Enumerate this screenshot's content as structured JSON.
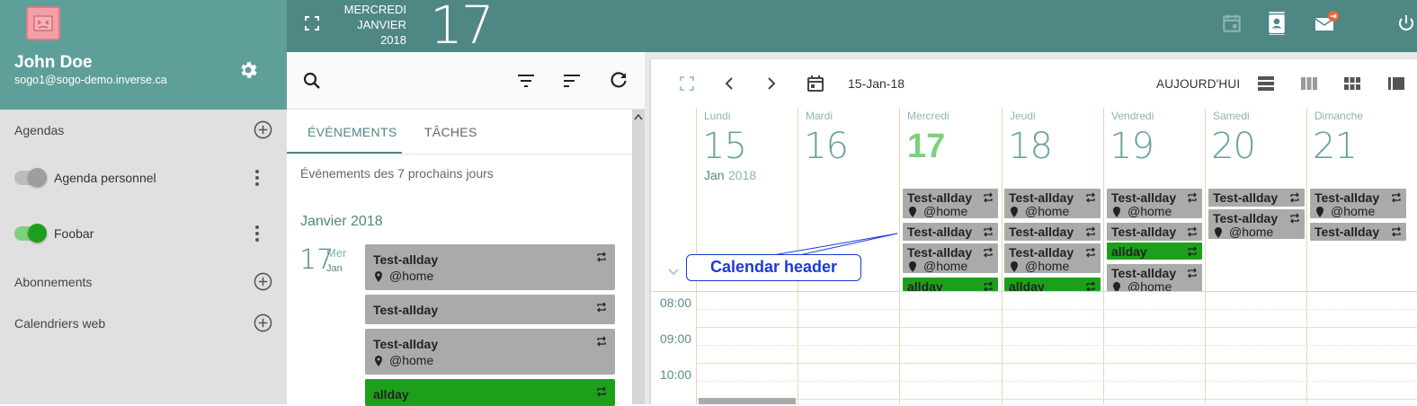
{
  "user": {
    "name": "John Doe",
    "email": "sogo1@sogo-demo.inverse.ca"
  },
  "sidebar": {
    "agendas_label": "Agendas",
    "calendars": [
      {
        "label": "Agenda personnel",
        "enabled": false
      },
      {
        "label": "Foobar",
        "enabled": true,
        "color": "#1ca01c"
      }
    ],
    "subscriptions_label": "Abonnements",
    "web_calendars_label": "Calendriers web"
  },
  "topbar": {
    "day_name": "MERCREDI",
    "month": "JANVIER",
    "year": "2018",
    "day": "17"
  },
  "list": {
    "tabs": [
      "ÉVÉNEMENTS",
      "TÂCHES"
    ],
    "subtitle": "Événements des 7 prochains jours",
    "month_heading": "Janvier 2018",
    "day": {
      "num": "17",
      "weekday": "Mer",
      "month": "Jan"
    },
    "events": [
      {
        "title": "Test-allday",
        "location": "@home"
      },
      {
        "title": "Test-allday",
        "location": ""
      },
      {
        "title": "Test-allday",
        "location": "@home"
      },
      {
        "title": "allday",
        "location": ""
      }
    ]
  },
  "calendar": {
    "date_label": "15-Jan-18",
    "today_label": "AUJOURD'HUI",
    "days": [
      {
        "name": "Lundi",
        "num": "15"
      },
      {
        "name": "Mardi",
        "num": "16"
      },
      {
        "name": "Mercredi",
        "num": "17"
      },
      {
        "name": "Jeudi",
        "num": "18"
      },
      {
        "name": "Vendredi",
        "num": "19"
      },
      {
        "name": "Samedi",
        "num": "20"
      },
      {
        "name": "Dimanche",
        "num": "21"
      }
    ],
    "month_label": "Jan",
    "year_label": "2018",
    "event_title": "Test-allday",
    "event_location": "@home",
    "allday_title": "allday",
    "hours": [
      "08:00",
      "09:00",
      "10:00"
    ]
  },
  "annotation": {
    "callout": "Calendar header"
  },
  "colors": {
    "header": "#5f9f99",
    "topbar": "#4f8784",
    "event_gray": "#aaaaaa",
    "event_green": "#1ca01c"
  }
}
